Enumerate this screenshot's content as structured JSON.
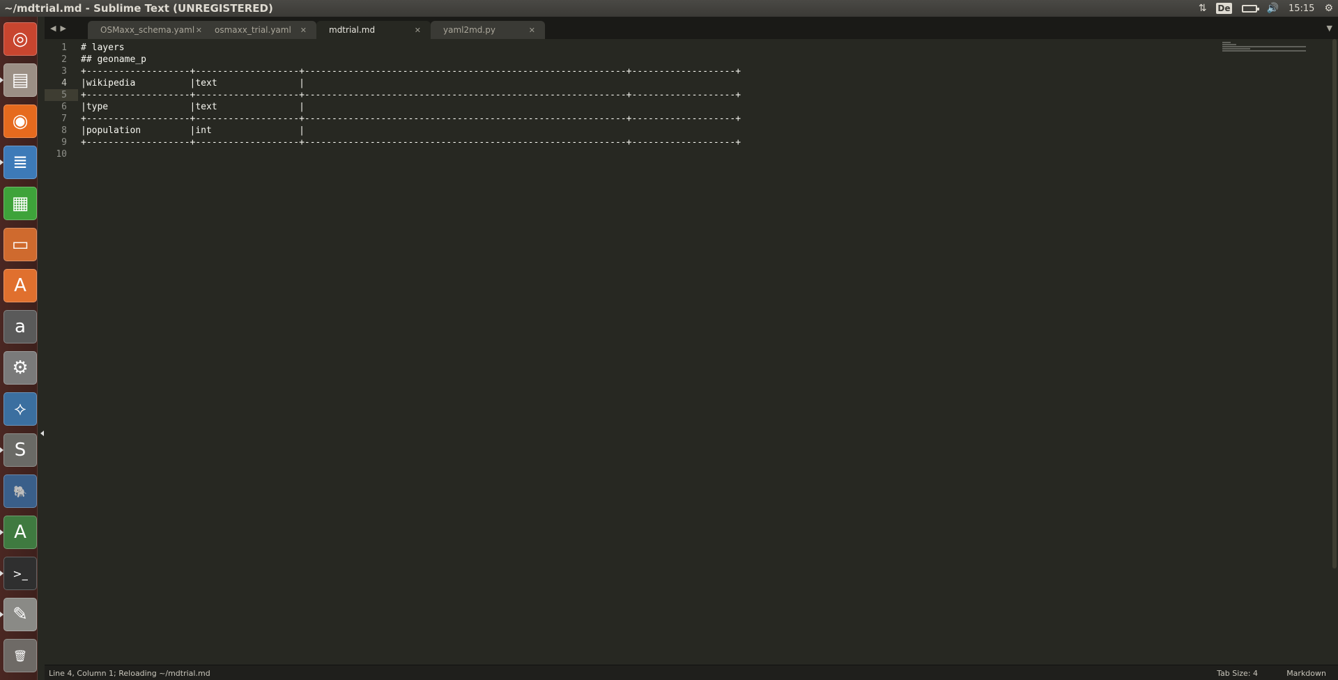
{
  "window": {
    "title": "~/mdtrial.md - Sublime Text (UNREGISTERED)"
  },
  "panel": {
    "indicators": [
      "network-transfer-icon",
      "keyboard-layout",
      "battery-icon",
      "volume-icon"
    ],
    "keyboard": "De",
    "clock": "15:15"
  },
  "launcher": {
    "items": [
      {
        "name": "ubuntu-dash-icon",
        "glyph": "◎",
        "bg": "#c8452f"
      },
      {
        "name": "files-icon",
        "glyph": "▤",
        "bg": "#9b8f85"
      },
      {
        "name": "firefox-icon",
        "glyph": "◉",
        "bg": "#e66a1e"
      },
      {
        "name": "writer-icon",
        "glyph": "≣",
        "bg": "#3d7ab8"
      },
      {
        "name": "calc-icon",
        "glyph": "▦",
        "bg": "#3ea33a"
      },
      {
        "name": "impress-icon",
        "glyph": "▭",
        "bg": "#cf6a2e"
      },
      {
        "name": "software-center-icon",
        "glyph": "A",
        "bg": "#e0702e"
      },
      {
        "name": "amazon-icon",
        "glyph": "a",
        "bg": "#5a5a5a"
      },
      {
        "name": "system-settings-icon",
        "glyph": "⚙",
        "bg": "#7a7a7a"
      },
      {
        "name": "python-icon",
        "glyph": "⟡",
        "bg": "#3b6fa0"
      },
      {
        "name": "sublime-text-icon",
        "glyph": "S",
        "bg": "#6a6a66"
      },
      {
        "name": "postgresql-icon",
        "glyph": "🐘",
        "bg": "#3a5f8a"
      },
      {
        "name": "software-updater-icon",
        "glyph": "A",
        "bg": "#3f7a40"
      },
      {
        "name": "terminal-icon",
        "glyph": ">_",
        "bg": "#2f2f2f"
      },
      {
        "name": "text-editor-icon",
        "glyph": "✎",
        "bg": "#8a8a86"
      },
      {
        "name": "trash-icon",
        "glyph": "🗑",
        "bg": "#6e6a66"
      }
    ]
  },
  "tabs": [
    {
      "label": "OSMaxx_schema.yaml",
      "active": false
    },
    {
      "label": "osmaxx_trial.yaml",
      "active": false
    },
    {
      "label": "mdtrial.md",
      "active": true
    },
    {
      "label": "yaml2md.py",
      "active": false
    }
  ],
  "editor": {
    "current_line": 4,
    "lines": [
      "# layers",
      "## geoname_p",
      "+-------------------+-------------------+-----------------------------------------------------------+-------------------+",
      "|wikipedia          |text               |",
      "+-------------------+-------------------+-----------------------------------------------------------+-------------------+",
      "|type               |text               |",
      "+-------------------+-------------------+-----------------------------------------------------------+-------------------+",
      "|population         |int                |",
      "+-------------------+-------------------+-----------------------------------------------------------+-------------------+",
      ""
    ],
    "line_numbers": [
      "1",
      "2",
      "3",
      "4",
      "5",
      "6",
      "7",
      "8",
      "9",
      "10"
    ]
  },
  "status": {
    "message": "Line 4, Column 1; Reloading ~/mdtrial.md",
    "tab_size": "Tab Size: 4",
    "syntax": "Markdown"
  }
}
